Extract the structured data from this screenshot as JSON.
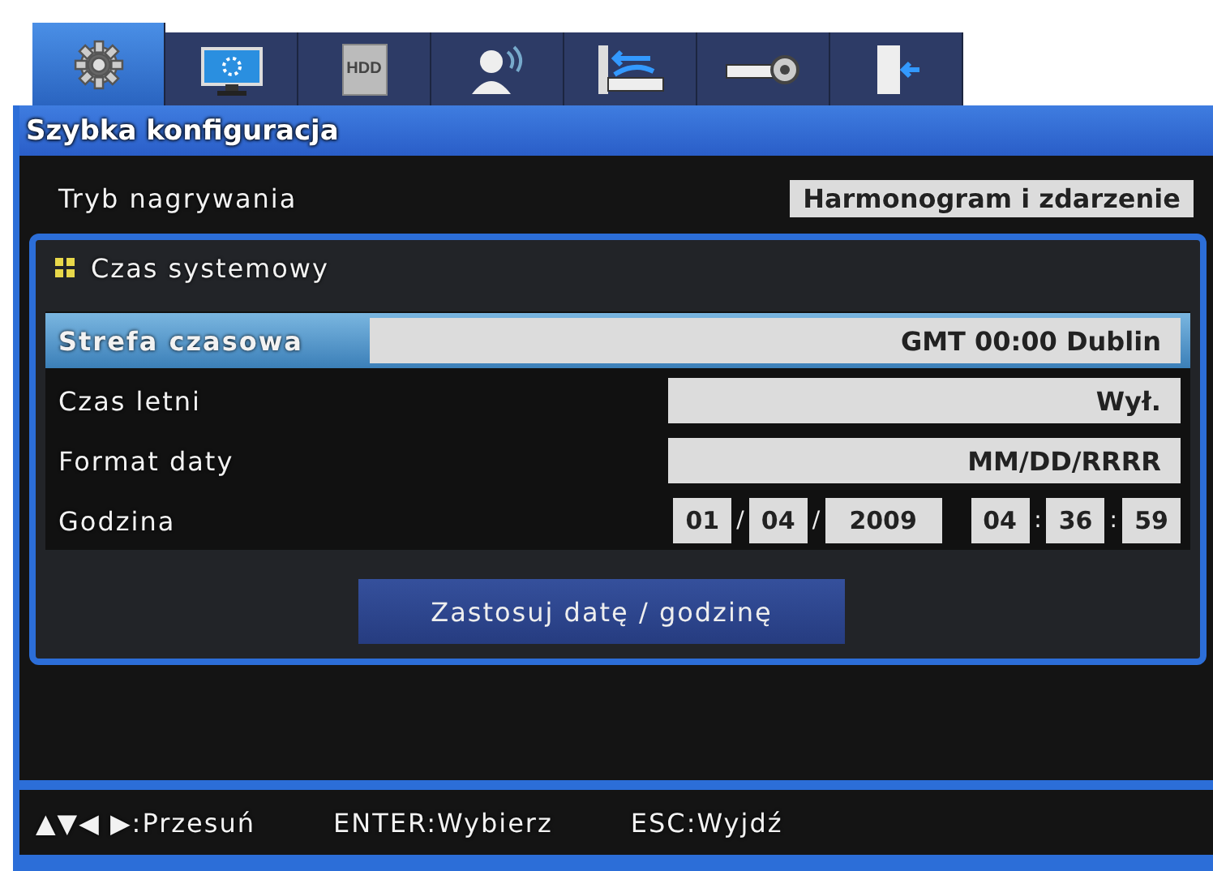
{
  "tabs": [
    {
      "kind": "gear",
      "selected": true
    },
    {
      "kind": "monitor",
      "selected": false
    },
    {
      "kind": "hdd",
      "label": "HDD",
      "selected": false
    },
    {
      "kind": "person",
      "selected": false
    },
    {
      "kind": "network",
      "selected": false
    },
    {
      "kind": "device",
      "selected": false
    },
    {
      "kind": "exit",
      "selected": false
    }
  ],
  "window": {
    "title": "Szybka konfiguracja"
  },
  "recording_mode": {
    "label": "Tryb nagrywania",
    "value": "Harmonogram i zdarzenie"
  },
  "system_time": {
    "title": "Czas systemowy",
    "rows": [
      {
        "kind": "field",
        "label": "Strefa czasowa",
        "value": "GMT 00:00 Dublin",
        "selected": true
      },
      {
        "kind": "field",
        "label": "Czas letni",
        "value": "Wył.",
        "selected": false
      },
      {
        "kind": "field",
        "label": "Format daty",
        "value": "MM/DD/RRRR",
        "selected": false
      },
      {
        "kind": "parts",
        "label": "Godzina",
        "selected": false,
        "parts": [
          {
            "kind": "field",
            "text": "01"
          },
          {
            "kind": "sep",
            "text": "/"
          },
          {
            "kind": "field",
            "text": "04"
          },
          {
            "kind": "sep",
            "text": "/"
          },
          {
            "kind": "wide",
            "text": "2009"
          },
          {
            "kind": "gap"
          },
          {
            "kind": "field",
            "text": "04"
          },
          {
            "kind": "sep",
            "text": ":"
          },
          {
            "kind": "field",
            "text": "36"
          },
          {
            "kind": "sep",
            "text": ":"
          },
          {
            "kind": "field",
            "text": "59"
          }
        ]
      }
    ],
    "button": "Zastosuj datę / godzinę"
  },
  "status_bar": [
    "▲▼◀ ▶:Przesuń",
    "ENTER:Wybierz",
    "ESC:Wyjdź"
  ]
}
